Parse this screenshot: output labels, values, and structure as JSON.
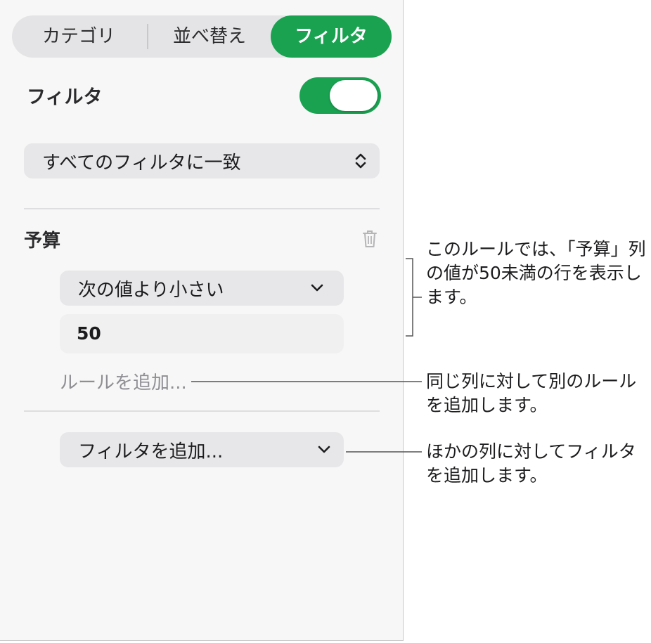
{
  "tabs": [
    {
      "label": "カテゴリ"
    },
    {
      "label": "並べ替え"
    },
    {
      "label": "フィルタ"
    }
  ],
  "filter": {
    "label": "フィルタ",
    "enabled": true,
    "match_mode": "すべてのフィルタに一致"
  },
  "rule_group": {
    "column_name": "予算",
    "condition": "次の値より小さい",
    "value": "50",
    "add_rule_label": "ルールを追加..."
  },
  "add_filter_label": "フィルタを追加...",
  "callouts": {
    "rule": "このルールでは、「予算」列の値が50未満の行を表示します。",
    "add_rule": "同じ列に対して別のルールを追加します。",
    "add_filter": "ほかの列に対してフィルタを追加します。"
  },
  "colors": {
    "accent": "#1aa251"
  }
}
